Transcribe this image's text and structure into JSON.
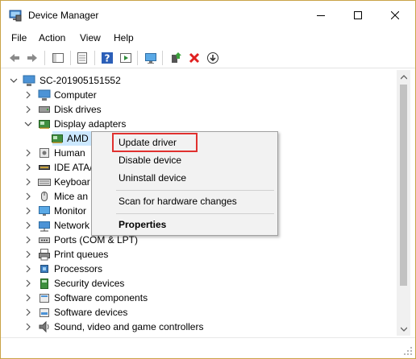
{
  "window": {
    "title": "Device Manager",
    "accent": "#c9a347"
  },
  "menu": [
    "File",
    "Action",
    "View",
    "Help"
  ],
  "toolbar": {
    "icons": [
      "back-arrow-icon",
      "forward-arrow-icon",
      "show-hide-tree-icon",
      "properties-icon",
      "help-icon",
      "run-icon",
      "monitor-icon",
      "add-driver-icon",
      "uninstall-icon",
      "update-down-arrow-icon"
    ],
    "uninstall_color": "#e02020"
  },
  "tree": {
    "root": "SC-201905151552",
    "items": [
      {
        "label": "Computer",
        "icon": "computer-icon"
      },
      {
        "label": "Disk drives",
        "icon": "disk-drive-icon"
      },
      {
        "label": "Display adapters",
        "icon": "display-adapter-icon",
        "expanded": true
      },
      {
        "label": "AMD",
        "icon": "display-adapter-icon",
        "child": true,
        "selected": true
      },
      {
        "label": "Human",
        "icon": "human-interface-icon"
      },
      {
        "label": "IDE ATA/",
        "icon": "ide-controller-icon"
      },
      {
        "label": "Keyboar",
        "icon": "keyboard-icon"
      },
      {
        "label": "Mice an",
        "icon": "mouse-icon"
      },
      {
        "label": "Monitor",
        "icon": "monitor-icon"
      },
      {
        "label": "Network",
        "icon": "network-adapter-icon"
      },
      {
        "label": "Ports (COM & LPT)",
        "icon": "port-icon"
      },
      {
        "label": "Print queues",
        "icon": "printer-icon"
      },
      {
        "label": "Processors",
        "icon": "processor-icon"
      },
      {
        "label": "Security devices",
        "icon": "security-device-icon"
      },
      {
        "label": "Software components",
        "icon": "software-component-icon"
      },
      {
        "label": "Software devices",
        "icon": "software-device-icon"
      },
      {
        "label": "Sound, video and game controllers",
        "icon": "sound-controller-icon"
      }
    ]
  },
  "context_menu": {
    "update_driver": "Update driver",
    "disable_device": "Disable device",
    "uninstall_device": "Uninstall device",
    "scan_hardware": "Scan for hardware changes",
    "properties": "Properties",
    "highlight_color": "#e0312f"
  }
}
